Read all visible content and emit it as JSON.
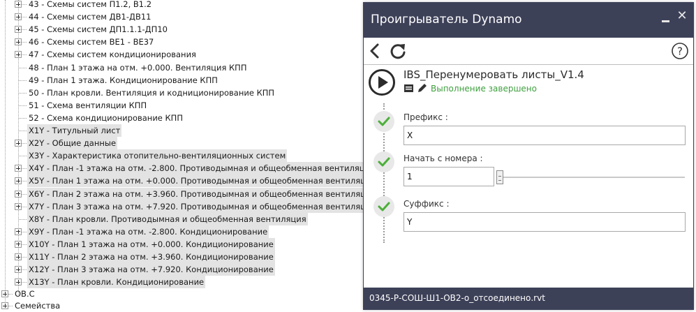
{
  "tree": {
    "items": [
      {
        "label": "43 - Схемы систем П1.2, В1.2",
        "expandable": true,
        "highlight": false
      },
      {
        "label": "44 - Схемы систем ДВ1-ДВ11",
        "expandable": true,
        "highlight": false
      },
      {
        "label": "45 - Схемы систем ДП1.1.1-ДП10",
        "expandable": true,
        "highlight": false
      },
      {
        "label": "46 - Схемы систем ВЕ1 - ВЕ37",
        "expandable": true,
        "highlight": false
      },
      {
        "label": "47 - Схемы систем кондиционирования",
        "expandable": true,
        "highlight": false
      },
      {
        "label": "48 - План 1 этажа на отм. +0.000. Вентиляция КПП",
        "expandable": false,
        "highlight": false
      },
      {
        "label": "49 - План 1 этажа. Кондиционирование КПП",
        "expandable": false,
        "highlight": false
      },
      {
        "label": "50 - План кровли. Вентиляция и коднициониров​ание КПП",
        "expandable": false,
        "highlight": false
      },
      {
        "label": "51 - Схема вентиляции КПП",
        "expandable": false,
        "highlight": false
      },
      {
        "label": "52 - Схема кондиционирование КПП",
        "expandable": false,
        "highlight": false
      },
      {
        "label": "X1Y - Титульный лист",
        "expandable": false,
        "highlight": true
      },
      {
        "label": "X2Y - Общие данные",
        "expandable": true,
        "highlight": true
      },
      {
        "label": "X3Y - Характеристика отопительно-вентиляционных систем",
        "expandable": false,
        "highlight": true
      },
      {
        "label": "X4Y - План -1 этажа на отм. -2.800. Противодымная и общеобменная вентиляция",
        "expandable": true,
        "highlight": true
      },
      {
        "label": "X5Y - План 1 этажа на отм. +0.000. Противодымная и общеобменная вентиляция",
        "expandable": true,
        "highlight": true
      },
      {
        "label": "X6Y - План 2 этажа на отм. +3.960. Противодымная и общеобменная вентиляция",
        "expandable": true,
        "highlight": true
      },
      {
        "label": "X7Y - План 3 этажа на отм. +7.920. Противодымная и общеобменная вентиляция",
        "expandable": true,
        "highlight": true
      },
      {
        "label": "X8Y - План кровли. Противодымная и общеобменная вентиляция",
        "expandable": false,
        "highlight": true
      },
      {
        "label": "X9Y - План -1 этажа на отм. -2.800. Кондиционирование",
        "expandable": true,
        "highlight": true
      },
      {
        "label": "X10Y - План 1 этажа на отм. +0.000. Кондиционирование",
        "expandable": true,
        "highlight": true
      },
      {
        "label": "X11Y - План 2 этажа на отм. +3.960. Кондиционирование",
        "expandable": true,
        "highlight": true
      },
      {
        "label": "X12Y - План 3 этажа на отм. +7.920. Кондиционирование",
        "expandable": true,
        "highlight": true
      },
      {
        "label": "X13Y - План кровли. Кондиционирование",
        "expandable": true,
        "highlight": true
      }
    ],
    "bottom_items": [
      {
        "label": "ОВ.С",
        "expandable": true
      },
      {
        "label": "Семейства",
        "expandable": true
      }
    ]
  },
  "player": {
    "title": "Проигрыватель Dynamo",
    "graph_name": "IBS_Перенумеровать листы_V1.4",
    "status": "Выполнение завершено",
    "status_color": "#3f9f3f",
    "header_color": "#3d4158",
    "inputs": [
      {
        "label": "Префикс :",
        "value": "X"
      },
      {
        "label": "Начать с номера :",
        "value": "1"
      },
      {
        "label": "Суффикс :",
        "value": "Y"
      }
    ],
    "footer": "0345-Р-СОШ-Ш1-ОВ2-о_отсоединено.rvt",
    "icons": [
      "back-arrow-icon",
      "refresh-icon",
      "help-icon",
      "play-icon",
      "graph-icon",
      "edit-icon",
      "check-icon"
    ]
  }
}
